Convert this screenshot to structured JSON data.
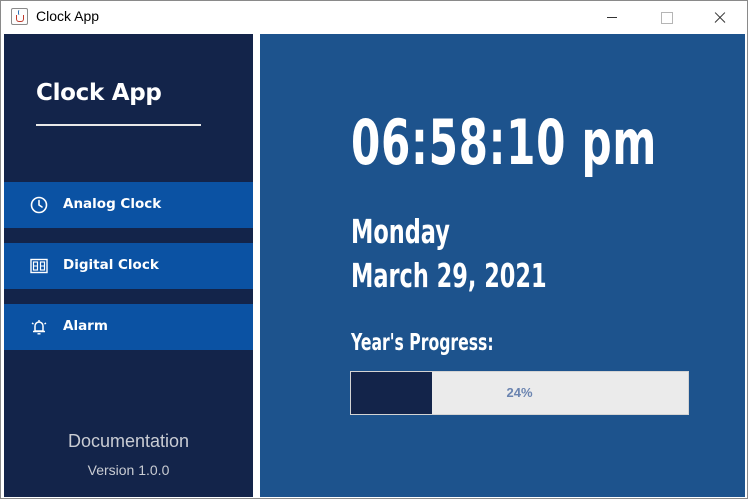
{
  "window": {
    "title": "Clock App"
  },
  "sidebar": {
    "brand": "Clock App",
    "items": [
      {
        "label": "Analog Clock",
        "icon": "clock-icon"
      },
      {
        "label": "Digital Clock",
        "icon": "digital-display-icon"
      },
      {
        "label": "Alarm",
        "icon": "alarm-bell-icon"
      }
    ],
    "footer": {
      "documentation": "Documentation",
      "version": "Version 1.0.0"
    }
  },
  "main": {
    "time": "06:58:10 pm",
    "day": "Monday",
    "date": "March 29, 2021",
    "progress_label": "Year's Progress:",
    "progress_value": 0.24,
    "progress_text": "24%"
  },
  "colors": {
    "sidebar_bg": "#13244a",
    "nav_item_bg": "#0b52a3",
    "main_bg": "#1d538d",
    "progress_fill": "#13244a",
    "progress_track": "#ebebeb"
  }
}
